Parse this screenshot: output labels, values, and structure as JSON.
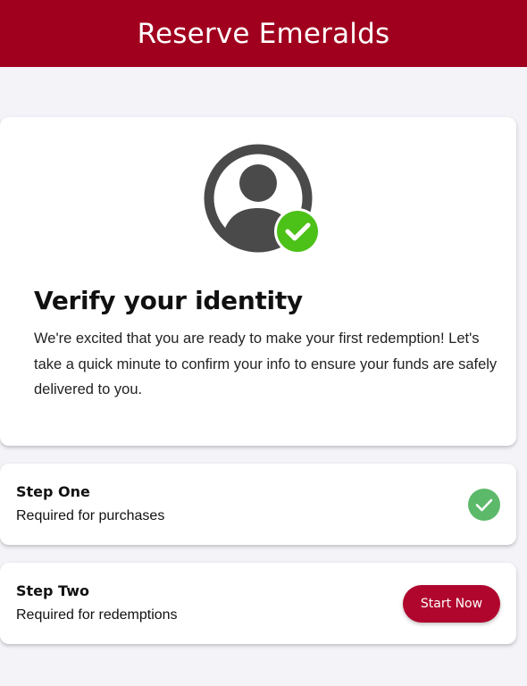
{
  "header": {
    "title": "Reserve Emeralds"
  },
  "verify": {
    "title": "Verify your identity",
    "body": "We're excited that you are ready to make your first redemption! Let's take a quick minute to confirm your info to ensure your funds are safely delivered to you."
  },
  "steps": [
    {
      "title": "Step One",
      "subtitle": "Required for purchases",
      "status": "complete"
    },
    {
      "title": "Step Two",
      "subtitle": "Required for redemptions",
      "action_label": "Start Now"
    }
  ],
  "colors": {
    "brand": "#a0001e",
    "button": "#b0062d",
    "avatar_check": "#4cc117",
    "step_check": "#5cb96a"
  },
  "icons": {
    "avatar": "user-avatar-icon",
    "avatar_badge": "check-badge-icon",
    "step_one_status": "check-circle-icon"
  }
}
